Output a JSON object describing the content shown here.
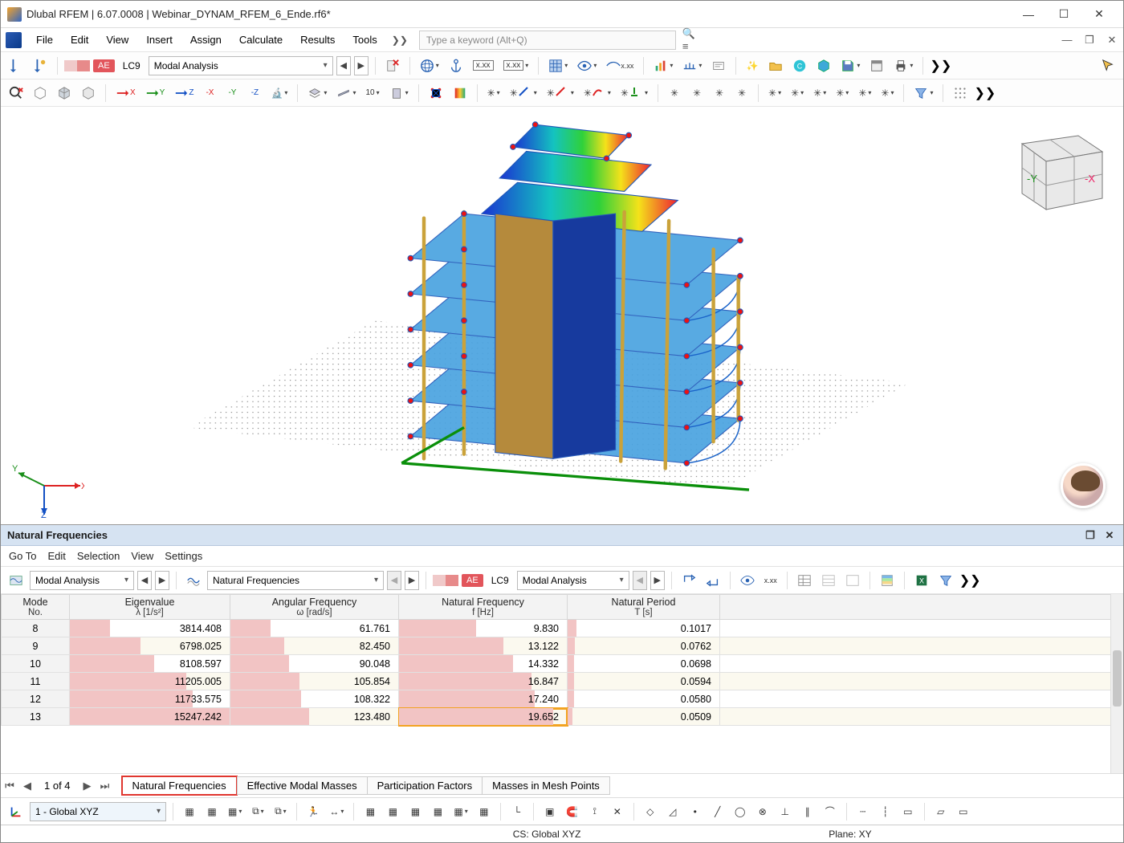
{
  "window": {
    "title": "Dlubal RFEM | 6.07.0008 | Webinar_DYNAM_RFEM_6_Ende.rf6*"
  },
  "menu": {
    "items": [
      "File",
      "Edit",
      "View",
      "Insert",
      "Assign",
      "Calculate",
      "Results",
      "Tools"
    ],
    "search_placeholder": "Type a keyword (Alt+Q)"
  },
  "main_toolbar": {
    "lc_label": "LC9",
    "loadcase_dd": "Modal Analysis"
  },
  "toolbar2_icons": [
    "view-reset",
    "box-wire",
    "box-solid",
    "box-iso",
    "axis-x",
    "axis-y",
    "axis-z",
    "axis-nx",
    "axis-ny",
    "axis-nz",
    "tool-microscope",
    "layer",
    "sheet",
    "ruler-10",
    "settings",
    "surf-a",
    "surf-b",
    "star1",
    "star2",
    "star3",
    "star4",
    "star5",
    "star6",
    "star7",
    "star8",
    "starA",
    "starB",
    "starC",
    "starD",
    "starE",
    "starF",
    "starG",
    "starH",
    "funnel",
    "more"
  ],
  "viewport": {
    "axes": {
      "x": "X",
      "y": "Y",
      "z": "Z"
    },
    "navcube": {
      "x": "-X",
      "y": "-Y"
    }
  },
  "panel": {
    "title": "Natural Frequencies",
    "menus": [
      "Go To",
      "Edit",
      "Selection",
      "View",
      "Settings"
    ],
    "dd_analysis": "Modal Analysis",
    "dd_result": "Natural Frequencies",
    "dd_loadcase": "Modal Analysis",
    "lc_label": "LC9",
    "pager": {
      "text": "1 of 4"
    },
    "tabs": [
      "Natural Frequencies",
      "Effective Modal Masses",
      "Participation Factors",
      "Masses in Mesh Points"
    ],
    "columns": [
      {
        "h": "Mode",
        "sub": "No."
      },
      {
        "h": "Eigenvalue",
        "sub": "λ [1/s²]"
      },
      {
        "h": "Angular Frequency",
        "sub": "ω [rad/s]"
      },
      {
        "h": "Natural Frequency",
        "sub": "f [Hz]"
      },
      {
        "h": "Natural Period",
        "sub": "T [s]"
      }
    ],
    "rows": [
      {
        "mode": "8",
        "vals": [
          "3814.408",
          "61.761",
          "9.830",
          "0.1017"
        ],
        "bars": [
          25,
          24,
          46,
          6
        ]
      },
      {
        "mode": "9",
        "vals": [
          "6798.025",
          "82.450",
          "13.122",
          "0.0762"
        ],
        "bars": [
          44,
          32,
          62,
          5
        ]
      },
      {
        "mode": "10",
        "vals": [
          "8108.597",
          "90.048",
          "14.332",
          "0.0698"
        ],
        "bars": [
          53,
          35,
          68,
          4
        ]
      },
      {
        "mode": "11",
        "vals": [
          "11205.005",
          "105.854",
          "16.847",
          "0.0594"
        ],
        "bars": [
          73,
          41,
          79,
          4
        ]
      },
      {
        "mode": "12",
        "vals": [
          "11733.575",
          "108.322",
          "17.240",
          "0.0580"
        ],
        "bars": [
          77,
          42,
          81,
          4
        ]
      },
      {
        "mode": "13",
        "vals": [
          "15247.242",
          "123.480",
          "19.652",
          "0.0509"
        ],
        "bars": [
          100,
          47,
          92,
          3
        ],
        "sel": 3
      }
    ]
  },
  "bottom": {
    "coord_dd": "1 - Global XYZ"
  },
  "status": {
    "cs": "CS: Global XYZ",
    "plane": "Plane: XY"
  }
}
